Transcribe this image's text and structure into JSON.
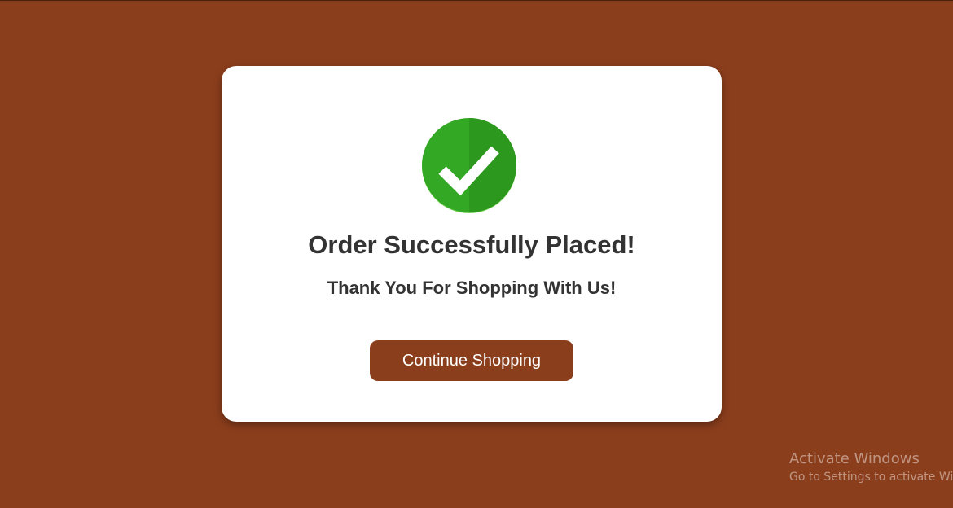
{
  "page": {
    "background_color": "#8b3e1c"
  },
  "dialog": {
    "icon": "check-circle-icon",
    "icon_color": "#2fa51e",
    "title": "Order Successfully Placed!",
    "subtitle": "Thank You For Shopping With Us!",
    "button_label": "Continue Shopping",
    "button_color": "#8b3e1c"
  },
  "watermark": {
    "title": "Activate Windows",
    "subtitle": "Go to Settings to activate Windows."
  }
}
